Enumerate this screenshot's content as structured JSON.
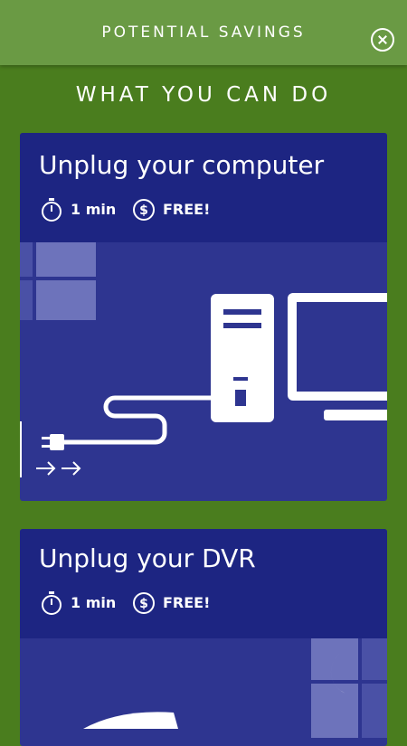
{
  "header": {
    "title": "POTENTIAL SAVINGS",
    "close_icon": "close-icon"
  },
  "section": {
    "heading": "WHAT YOU CAN DO"
  },
  "cards": [
    {
      "title": "Unplug your computer",
      "time": "1 min",
      "cost": "FREE!"
    },
    {
      "title": "Unplug your DVR",
      "time": "1 min",
      "cost": "FREE!"
    }
  ],
  "colors": {
    "background": "#4a7d1e",
    "header_bg": "#6a9a44",
    "card_header": "#1d2582",
    "card_body": "#2e3590"
  }
}
